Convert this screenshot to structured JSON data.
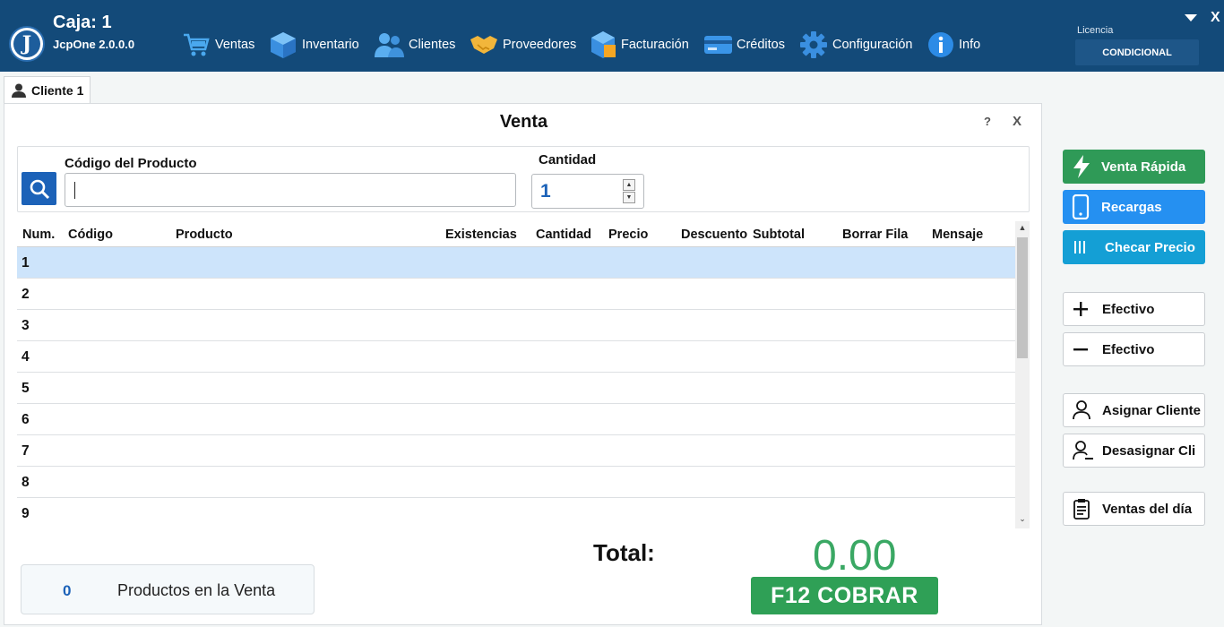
{
  "header": {
    "caja": "Caja: 1",
    "version": "JcpOne 2.0.0.0",
    "license_label": "Licencia",
    "license_value": "CONDICIONAL",
    "close": "X",
    "nav": [
      {
        "label": "Ventas",
        "icon": "cart-icon"
      },
      {
        "label": "Inventario",
        "icon": "box-icon"
      },
      {
        "label": "Clientes",
        "icon": "users-icon"
      },
      {
        "label": "Proveedores",
        "icon": "handshake-icon"
      },
      {
        "label": "Facturación",
        "icon": "invoice-icon"
      },
      {
        "label": "Créditos",
        "icon": "credit-card-icon"
      },
      {
        "label": "Configuración",
        "icon": "gear-icon"
      },
      {
        "label": "Info",
        "icon": "info-icon"
      }
    ]
  },
  "tab": {
    "label": "Cliente 1"
  },
  "venta": {
    "title": "Venta",
    "help": "?",
    "close": "X",
    "code_label": "Código del Producto",
    "code_value": "",
    "qty_label": "Cantidad",
    "qty_value": "1",
    "columns": [
      "Num.",
      "Código",
      "Producto",
      "Existencias",
      "Cantidad",
      "Precio",
      "Descuento",
      "Subtotal",
      "Borrar Fila",
      "Mensaje"
    ],
    "rows": [
      "1",
      "2",
      "3",
      "4",
      "5",
      "6",
      "7",
      "8",
      "9"
    ],
    "products_count": "0",
    "products_label": "Productos en la Venta",
    "total_label": "Total:",
    "total_value": "0.00",
    "cobrar_label": "F12  COBRAR"
  },
  "side": {
    "venta_rapida": "Venta Rápida",
    "recargas": "Recargas",
    "checar_precio": "Checar Precio",
    "efectivo_in": "Efectivo",
    "efectivo_out": "Efectivo",
    "asignar_cliente": "Asignar Cliente",
    "desasignar_cli": "Desasignar Cli",
    "ventas_dia": "Ventas del día"
  },
  "colors": {
    "topbar": "#134a79",
    "accent_blue": "#1c62b8",
    "green": "#2fa056",
    "total_green": "#3aa864",
    "venta_rapida": "#2f9a57",
    "recargas": "#2590f1",
    "checar_precio": "#149fd5",
    "selected_row": "#cde4fb"
  }
}
